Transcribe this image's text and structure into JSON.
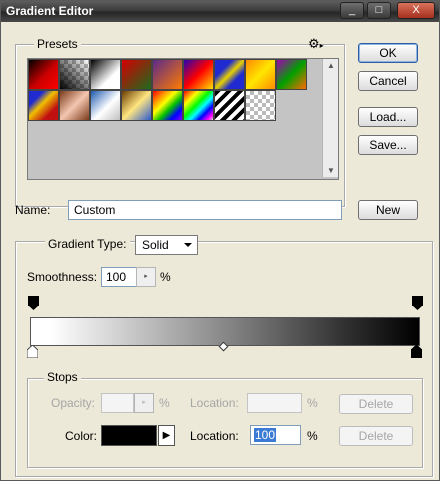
{
  "window": {
    "title": "Gradient Editor",
    "buttons": [
      "_",
      "□",
      "X"
    ]
  },
  "presets": {
    "label": "Presets",
    "menu_icon": "gear-icon",
    "swatches": [
      {
        "bg": "linear-gradient(135deg,#000 0%,#c00 55%,#ff0000 100%)"
      },
      {
        "bg": "linear-gradient(45deg,#000 0%,rgba(0,0,0,0) 100%), repeating-conic-gradient(#bbb 0% 25%, #fff 0% 50%) 0 0/8px 8px"
      },
      {
        "bg": "linear-gradient(135deg,#000 0%,#fff 65%,#fff 100%)"
      },
      {
        "bg": "linear-gradient(135deg,#d40000 0%,#1d6b1d 100%)"
      },
      {
        "bg": "linear-gradient(135deg,#5b2a8a 0%,#ff7a00 100%)"
      },
      {
        "bg": "linear-gradient(135deg,#2a00b0 0%,#ff0000 50%,#ffe000 100%)"
      },
      {
        "bg": "linear-gradient(135deg,#1f2bd0 30%,#e7d000 50%,#1f2bd0 70%)"
      },
      {
        "bg": "linear-gradient(135deg,#ff8a00 0%,#ffe600 50%,#ff8a00 100%)"
      },
      {
        "bg": "linear-gradient(135deg,#a000b0 0%,#00a000 50%,#ff6a00 100%)"
      },
      {
        "bg": "linear-gradient(135deg,#1f2bd0 25%,#f0c000 45%,#c01010 75%)"
      },
      {
        "bg": "linear-gradient(135deg,#7a3a1a 0%,#f4c6b0 50%,#7a3a1a 100%)"
      },
      {
        "bg": "linear-gradient(135deg,#1e5ab0 0%,#ffffff 55%,#c0c0c0 100%)"
      },
      {
        "bg": "linear-gradient(135deg,#6a3a00 0%,#ffe680 50%,#2a5ad0 100%)"
      },
      {
        "bg": "linear-gradient(135deg,#ff0000,#ff8000,#ffff00,#00c000,#0000ff,#8000ff)"
      },
      {
        "bg": "linear-gradient(135deg,#ff0000 0%,#ffff00 25%,#00ff00 45%,#00ffff 60%,#0000ff 75%,#ff00ff 90%,rgba(255,255,255,0) 100%), repeating-conic-gradient(#bbb 0% 25%, #fff 0% 50%) 0 0/8px 8px"
      },
      {
        "bg": "repeating-linear-gradient(135deg,#000 0 4px,#fff 4px 8px)"
      },
      {
        "bg": "repeating-conic-gradient(#bbb 0% 25%, #fff 0% 50%) 0 0/8px 8px"
      }
    ]
  },
  "actions": {
    "ok": "OK",
    "cancel": "Cancel",
    "load": "Load...",
    "save": "Save..."
  },
  "name": {
    "label": "Name:",
    "value": "Custom",
    "new_button": "New"
  },
  "gradient": {
    "type_label": "Gradient Type:",
    "type_value": "Solid",
    "smoothness_label": "Smoothness:",
    "smoothness_value": "100",
    "smoothness_unit": "%",
    "colors": {
      "start": "#ffffff",
      "end": "#000000"
    }
  },
  "stops": {
    "label": "Stops",
    "opacity_label": "Opacity:",
    "opacity_value": "",
    "opacity_unit": "%",
    "opacity_location_label": "Location:",
    "opacity_location_value": "",
    "opacity_location_unit": "%",
    "delete_label": "Delete",
    "color_label": "Color:",
    "color_value": "#000000",
    "color_location_label": "Location:",
    "color_location_value": "100",
    "color_location_unit": "%",
    "delete_label_2": "Delete"
  }
}
